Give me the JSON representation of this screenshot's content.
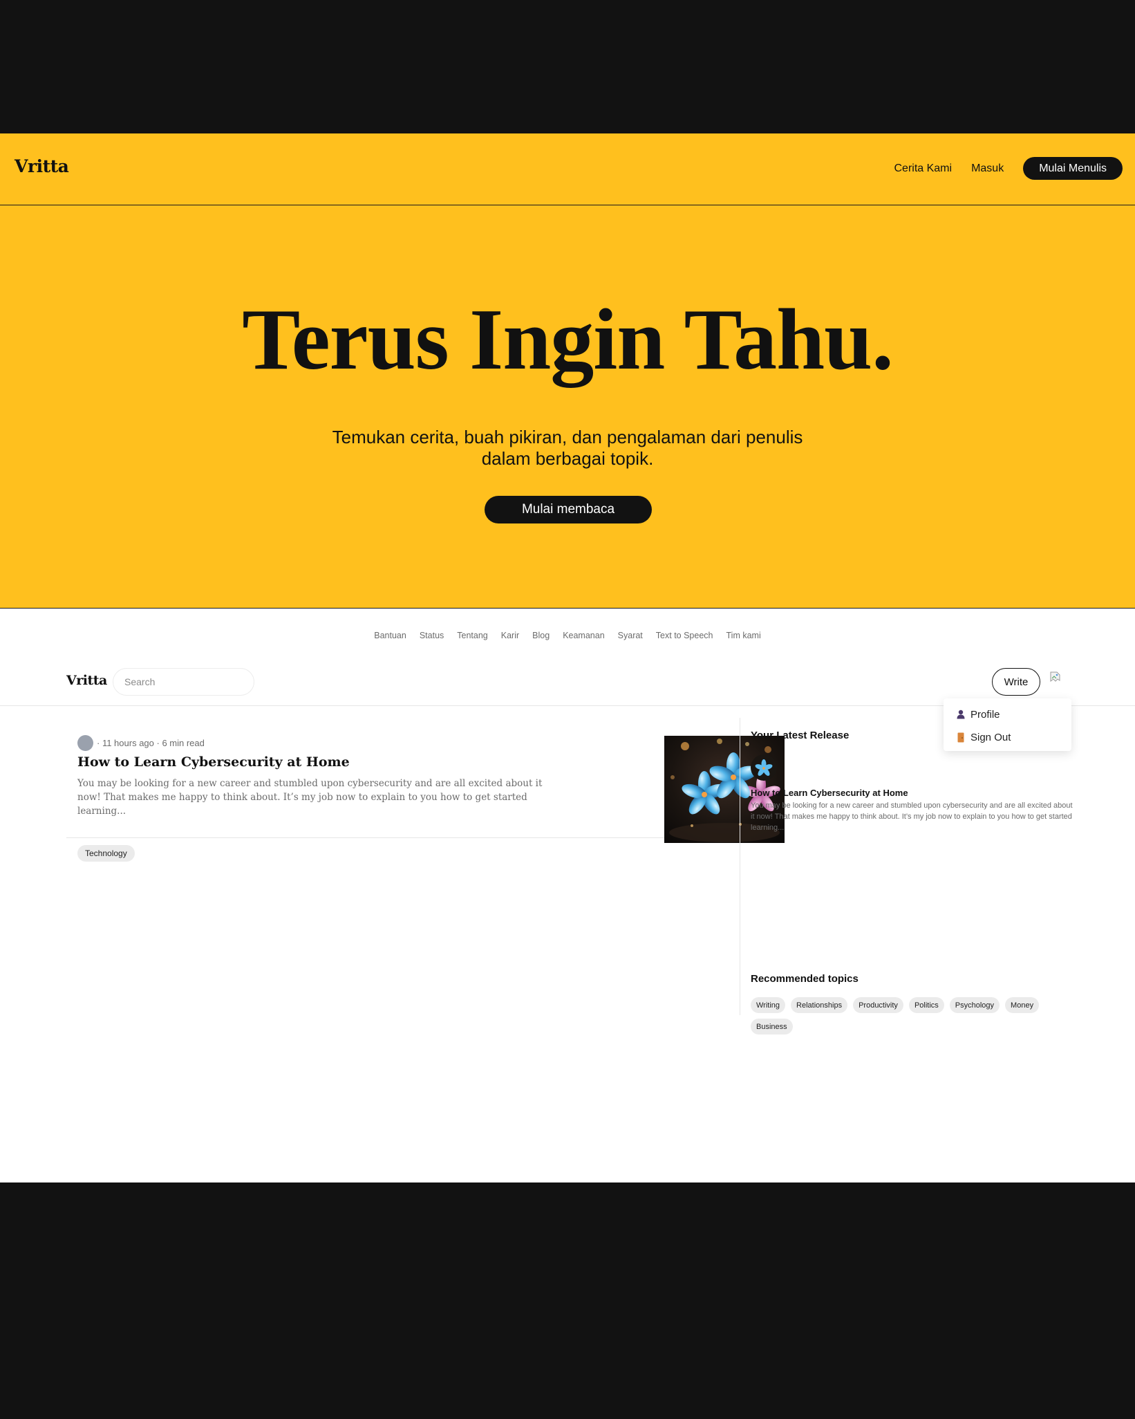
{
  "landing": {
    "logo": "Vritta",
    "nav": {
      "story": "Cerita Kami",
      "login": "Masuk",
      "start_writing": "Mulai Menulis"
    },
    "hero": {
      "title": "Terus Ingin Tahu.",
      "subtitle_line1": "Temukan cerita, buah pikiran, dan pengalaman dari penulis",
      "subtitle_line2": "dalam berbagai topik.",
      "button": "Mulai membaca"
    },
    "brand_color": "#ffc01e"
  },
  "footer_links": [
    "Bantuan",
    "Status",
    "Tentang",
    "Karir",
    "Blog",
    "Keamanan",
    "Syarat",
    "Text to Speech",
    "Tim kami"
  ],
  "app": {
    "logo": "Vritta",
    "search_placeholder": "Search",
    "write_label": "Write",
    "avatar_icon": "broken-image-icon",
    "dropdown": {
      "profile": "Profile",
      "profile_icon": "person-icon",
      "sign_out": "Sign Out",
      "sign_out_icon": "door-icon"
    }
  },
  "feed": {
    "articles": [
      {
        "time": "11 hours ago",
        "read_time": "6 min read",
        "title": "How to Learn Cybersecurity at Home",
        "excerpt": "You may be looking for a new career and stumbled upon cybersecurity and are all excited about it now! That makes me happy to think about. It’s my job now to explain to you how to get started learning...",
        "tag": "Technology",
        "thumbnail": "blue-flowers-image"
      }
    ]
  },
  "sidebar": {
    "latest_heading": "Your Latest Release",
    "latest": {
      "title": "How to Learn Cybersecurity at Home",
      "excerpt": "You may be looking for a new career and stumbled upon cybersecurity and are all excited about it now! That makes me happy to think about. It’s my job now to explain to you how to get started learning..."
    },
    "topics_heading": "Recommended topics",
    "topics": [
      "Writing",
      "Relationships",
      "Productivity",
      "Politics",
      "Psychology",
      "Money",
      "Business"
    ]
  }
}
